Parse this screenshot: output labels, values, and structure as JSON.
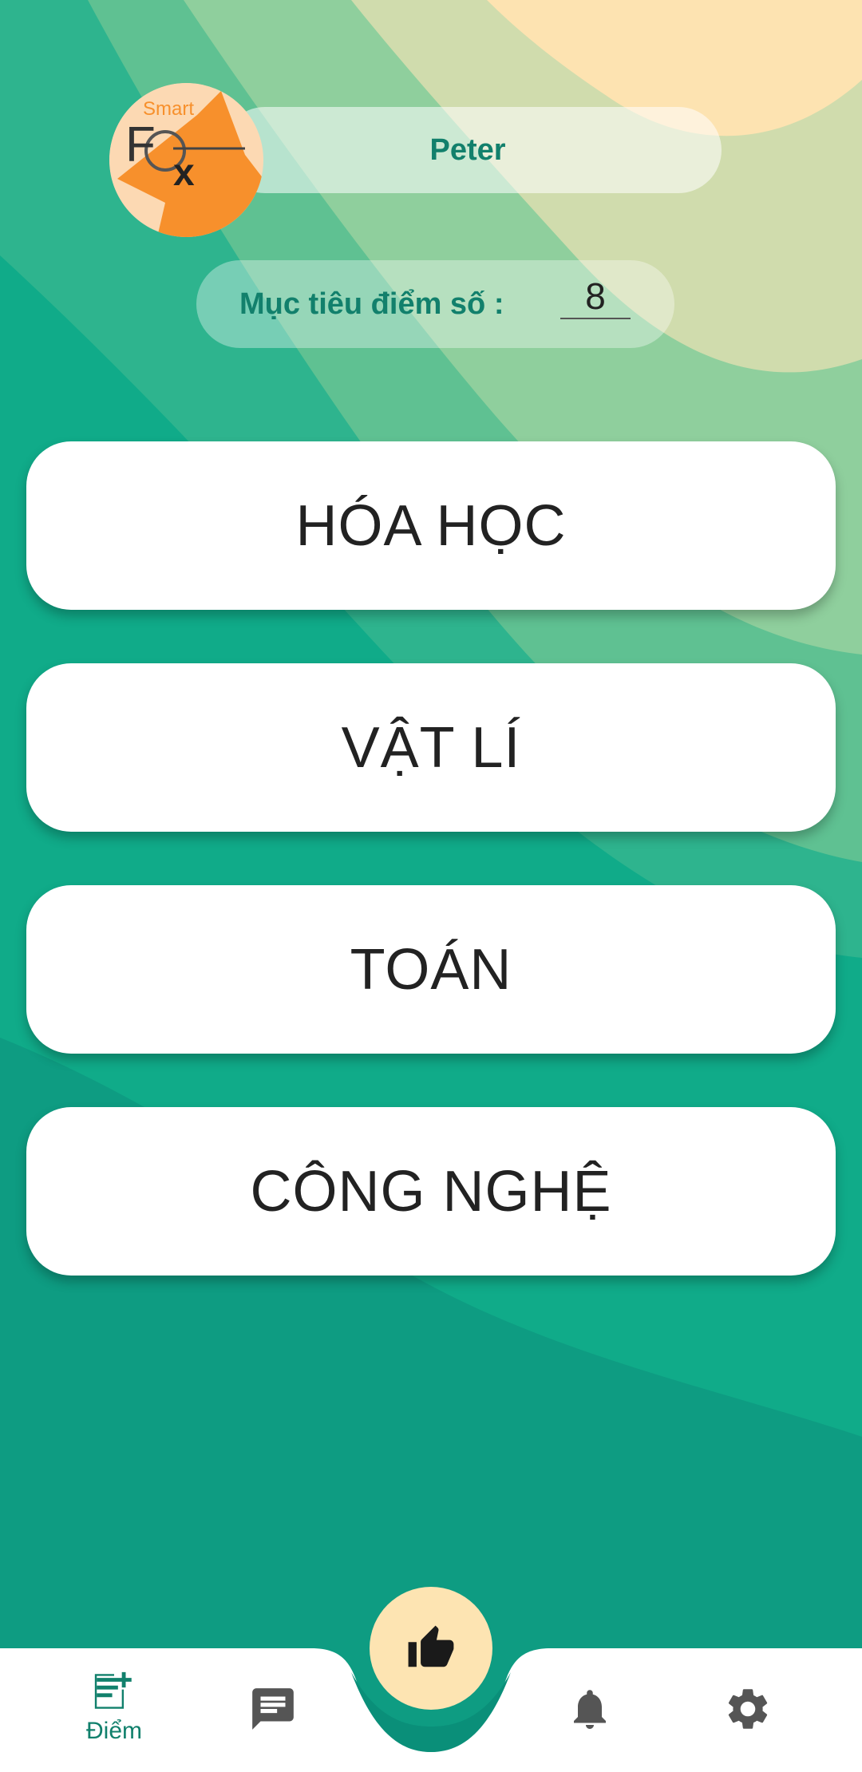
{
  "profile": {
    "name": "Peter",
    "logo_text": {
      "word": "Smart",
      "f": "F",
      "x": "x"
    }
  },
  "goal": {
    "label": "Mục tiêu điểm số :",
    "value": "8"
  },
  "subjects": [
    {
      "label": "HÓA HỌC"
    },
    {
      "label": "VẬT LÍ"
    },
    {
      "label": "TOÁN"
    },
    {
      "label": "CÔNG NGHỆ"
    }
  ],
  "nav": {
    "items": [
      {
        "label": "Điểm",
        "icon": "note-add-icon",
        "active": true
      },
      {
        "label": "",
        "icon": "chat-icon",
        "active": false
      },
      {
        "label": "",
        "icon": "bell-icon",
        "active": false
      },
      {
        "label": "",
        "icon": "gear-icon",
        "active": false
      }
    ],
    "fab_icon": "thumbs-up-icon"
  },
  "colors": {
    "teal": "#10a886",
    "teal_dark": "#0a8f79",
    "peach": "#fde4b2",
    "fox_orange": "#f7902c",
    "label_teal": "#12806c",
    "icon_gray": "#555555"
  }
}
